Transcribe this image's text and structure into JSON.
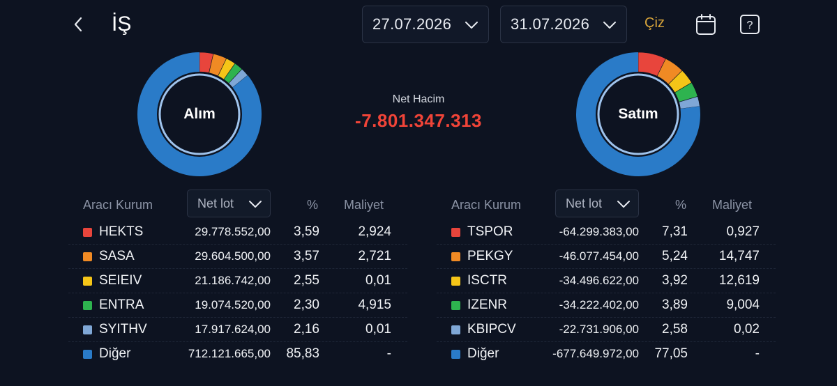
{
  "header": {
    "title": "İŞ",
    "start_date": "27.07.2026",
    "end_date": "31.07.2026",
    "draw_label": "Çiz"
  },
  "summary": {
    "buy_label": "Alım",
    "sell_label": "Satım",
    "net_volume_label": "Net Hacim",
    "net_volume_value": "-7.801.347.313"
  },
  "colors": {
    "background": "#0d1321",
    "negative": "#f04438",
    "accent": "#d9a53b"
  },
  "buy": {
    "col_broker": "Aracı Kurum",
    "col_select": "Net lot",
    "col_pct": "%",
    "col_cost": "Maliyet",
    "rows": [
      {
        "name": "HEKTS",
        "lot": "29.778.552,00",
        "pct": "3,59",
        "cost": "2,924",
        "color": "#e8453c",
        "share": 3.59
      },
      {
        "name": "SASA",
        "lot": "29.604.500,00",
        "pct": "3,57",
        "cost": "2,721",
        "color": "#f08a24",
        "share": 3.57
      },
      {
        "name": "SEIEIV",
        "lot": "21.186.742,00",
        "pct": "2,55",
        "cost": "0,01",
        "color": "#f5c518",
        "share": 2.55
      },
      {
        "name": "ENTRA",
        "lot": "19.074.520,00",
        "pct": "2,30",
        "cost": "4,915",
        "color": "#2eb34f",
        "share": 2.3
      },
      {
        "name": "SYITHV",
        "lot": "17.917.624,00",
        "pct": "2,16",
        "cost": "0,01",
        "color": "#7fa7d6",
        "share": 2.16
      },
      {
        "name": "Diğer",
        "lot": "712.121.665,00",
        "pct": "85,83",
        "cost": "-",
        "color": "#2a7bc8",
        "share": 85.83
      }
    ]
  },
  "sell": {
    "col_broker": "Aracı Kurum",
    "col_select": "Net lot",
    "col_pct": "%",
    "col_cost": "Maliyet",
    "rows": [
      {
        "name": "TSPOR",
        "lot": "-64.299.383,00",
        "pct": "7,31",
        "cost": "0,927",
        "color": "#e8453c",
        "share": 7.31
      },
      {
        "name": "PEKGY",
        "lot": "-46.077.454,00",
        "pct": "5,24",
        "cost": "14,747",
        "color": "#f08a24",
        "share": 5.24
      },
      {
        "name": "ISCTR",
        "lot": "-34.496.622,00",
        "pct": "3,92",
        "cost": "12,619",
        "color": "#f5c518",
        "share": 3.92
      },
      {
        "name": "IZENR",
        "lot": "-34.222.402,00",
        "pct": "3,89",
        "cost": "9,004",
        "color": "#2eb34f",
        "share": 3.89
      },
      {
        "name": "KBIPCV",
        "lot": "-22.731.906,00",
        "pct": "2,58",
        "cost": "0,02",
        "color": "#7fa7d6",
        "share": 2.58
      },
      {
        "name": "Diğer",
        "lot": "-677.649.972,00",
        "pct": "77,05",
        "cost": "-",
        "color": "#2a7bc8",
        "share": 77.05
      }
    ]
  }
}
